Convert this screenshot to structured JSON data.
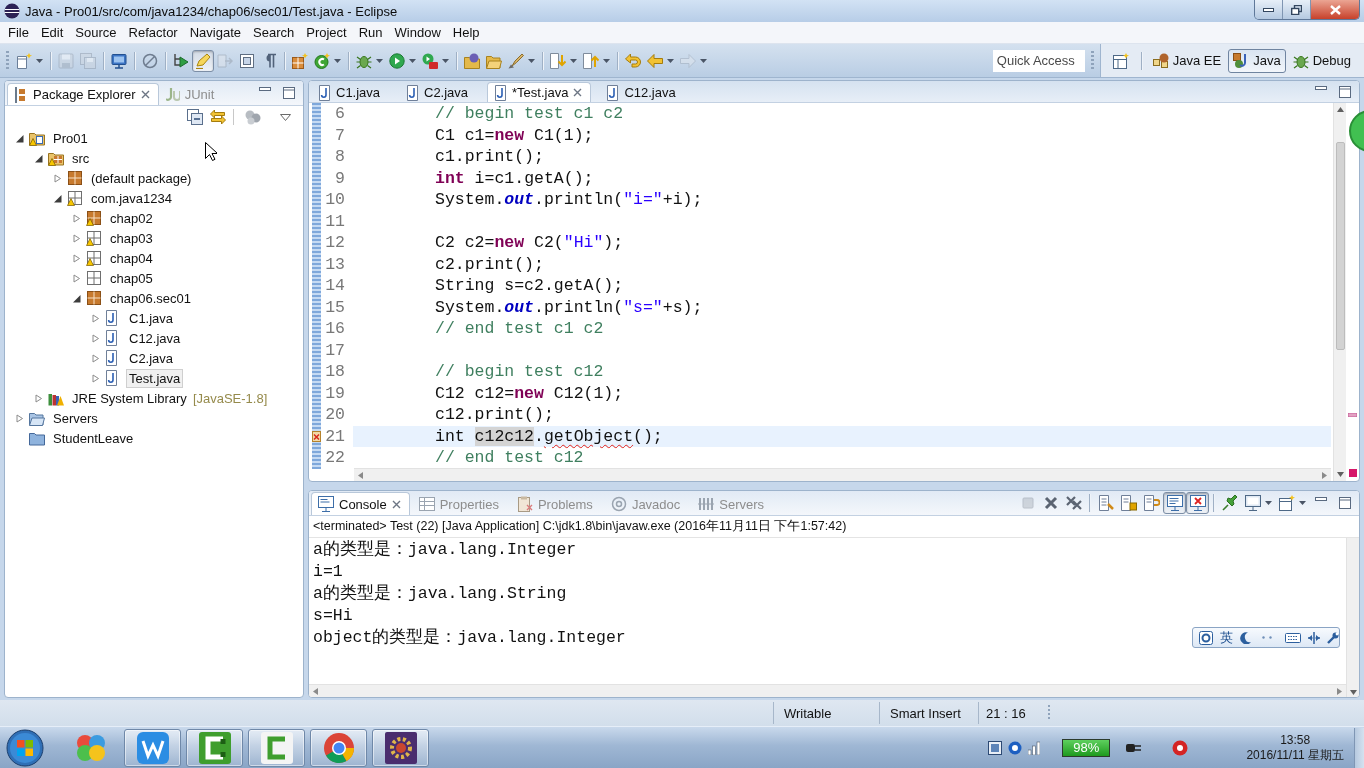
{
  "window": {
    "title": "Java - Pro01/src/com/java1234/chap06/sec01/Test.java - Eclipse"
  },
  "menu": [
    "File",
    "Edit",
    "Source",
    "Refactor",
    "Navigate",
    "Search",
    "Project",
    "Run",
    "Window",
    "Help"
  ],
  "toolbar": {
    "buttons": [
      {
        "pressed": false,
        "menu": true,
        "disabled": false
      },
      {
        "pressed": false,
        "menu": false,
        "disabled": true
      },
      {
        "pressed": false,
        "menu": false,
        "disabled": true
      },
      {
        "pressed": false,
        "menu": false,
        "disabled": false
      },
      {
        "pressed": false,
        "menu": false,
        "disabled": false
      },
      {
        "pressed": false,
        "menu": false,
        "disabled": false
      },
      {
        "pressed": true,
        "menu": false,
        "disabled": false
      },
      {
        "pressed": false,
        "menu": false,
        "disabled": true
      },
      {
        "pressed": false,
        "menu": false,
        "disabled": false
      },
      {
        "pressed": false,
        "menu": false,
        "disabled": false
      },
      {
        "pressed": false,
        "menu": false,
        "disabled": false
      },
      {
        "pressed": false,
        "menu": true,
        "disabled": false
      },
      {
        "pressed": false,
        "menu": true,
        "disabled": false
      },
      {
        "pressed": false,
        "menu": true,
        "disabled": false
      },
      {
        "pressed": false,
        "menu": true,
        "disabled": false
      },
      {
        "pressed": false,
        "menu": false,
        "disabled": false
      },
      {
        "pressed": false,
        "menu": false,
        "disabled": false
      },
      {
        "pressed": false,
        "menu": true,
        "disabled": false
      },
      {
        "pressed": false,
        "menu": true,
        "disabled": false
      },
      {
        "pressed": false,
        "menu": true,
        "disabled": false
      },
      {
        "pressed": false,
        "menu": false,
        "disabled": false
      },
      {
        "pressed": false,
        "menu": true,
        "disabled": false
      },
      {
        "pressed": false,
        "menu": true,
        "disabled": true
      }
    ],
    "quick_access": {
      "placeholder": "Quick Access"
    },
    "perspectives": [
      {
        "label": "Java EE",
        "selected": false
      },
      {
        "label": "Java",
        "selected": true
      },
      {
        "label": "Debug",
        "selected": false
      }
    ]
  },
  "package_explorer": {
    "tabs": [
      {
        "label": "Package Explorer",
        "selected": true
      },
      {
        "label": "JUnit",
        "selected": false
      }
    ],
    "tree": [
      {
        "label": "Pro01",
        "kind": "project",
        "warning": true,
        "expanded": true,
        "selected": false,
        "children": [
          {
            "label": "src",
            "kind": "source-folder",
            "warning": true,
            "expanded": true,
            "selected": false,
            "children": [
              {
                "label": "(default package)",
                "kind": "package",
                "warning": false,
                "expanded": false,
                "selected": false
              },
              {
                "label": "com.java1234",
                "kind": "empty-package",
                "warning": true,
                "expanded": true,
                "selected": false,
                "children": [
                  {
                    "label": "chap02",
                    "kind": "package",
                    "warning": true,
                    "expanded": false,
                    "selected": false
                  },
                  {
                    "label": "chap03",
                    "kind": "empty-package",
                    "warning": true,
                    "expanded": false,
                    "selected": false
                  },
                  {
                    "label": "chap04",
                    "kind": "empty-package",
                    "warning": true,
                    "expanded": false,
                    "selected": false
                  },
                  {
                    "label": "chap05",
                    "kind": "empty-package",
                    "warning": false,
                    "expanded": false,
                    "selected": false
                  },
                  {
                    "label": "chap06.sec01",
                    "kind": "package",
                    "warning": false,
                    "expanded": true,
                    "selected": false,
                    "children": [
                      {
                        "label": "C1.java",
                        "kind": "java-file",
                        "warning": false,
                        "expanded": false,
                        "selected": false
                      },
                      {
                        "label": "C12.java",
                        "kind": "java-file",
                        "warning": false,
                        "expanded": false,
                        "selected": false
                      },
                      {
                        "label": "C2.java",
                        "kind": "java-file",
                        "warning": false,
                        "expanded": false,
                        "selected": false
                      },
                      {
                        "label": "Test.java",
                        "kind": "java-file",
                        "warning": false,
                        "expanded": false,
                        "selected": true
                      }
                    ]
                  }
                ]
              }
            ]
          },
          {
            "label": "JRE System Library",
            "decoration": "[JavaSE-1.8]",
            "kind": "library",
            "warning": false,
            "expanded": false,
            "selected": false
          }
        ]
      },
      {
        "label": "Servers",
        "kind": "folder",
        "warning": false,
        "expanded": false,
        "selected": false
      },
      {
        "label": "StudentLeave",
        "kind": "closed-project",
        "warning": false,
        "selected": false
      }
    ]
  },
  "editor": {
    "tabs": [
      {
        "label": "C1.java",
        "selected": false
      },
      {
        "label": "C2.java",
        "selected": false
      },
      {
        "label": "*Test.java",
        "selected": true
      },
      {
        "label": "C12.java",
        "selected": false
      }
    ],
    "lines": [
      {
        "number": "6",
        "current": false,
        "error_marker": false,
        "tokens": [
          {
            "text": "// begin test c1 c2",
            "kind": "comment"
          }
        ]
      },
      {
        "number": "7",
        "current": false,
        "error_marker": false,
        "tokens": [
          {
            "text": "C1 c1=",
            "kind": "plain"
          },
          {
            "text": "new",
            "kind": "keyword"
          },
          {
            "text": " C1(1);",
            "kind": "plain"
          }
        ]
      },
      {
        "number": "8",
        "current": false,
        "error_marker": false,
        "tokens": [
          {
            "text": "c1.print();",
            "kind": "plain"
          }
        ]
      },
      {
        "number": "9",
        "current": false,
        "error_marker": false,
        "tokens": [
          {
            "text": "int",
            "kind": "keyword"
          },
          {
            "text": " i=c1.getA();",
            "kind": "plain"
          }
        ]
      },
      {
        "number": "10",
        "current": false,
        "error_marker": false,
        "tokens": [
          {
            "text": "System.",
            "kind": "plain"
          },
          {
            "text": "out",
            "kind": "field"
          },
          {
            "text": ".println(",
            "kind": "plain"
          },
          {
            "text": "\"i=\"",
            "kind": "string"
          },
          {
            "text": "+i);",
            "kind": "plain"
          }
        ]
      },
      {
        "number": "11",
        "current": false,
        "error_marker": false
      },
      {
        "number": "12",
        "current": false,
        "error_marker": false,
        "tokens": [
          {
            "text": "C2 c2=",
            "kind": "plain"
          },
          {
            "text": "new",
            "kind": "keyword"
          },
          {
            "text": " C2(",
            "kind": "plain"
          },
          {
            "text": "\"Hi\"",
            "kind": "string"
          },
          {
            "text": ");",
            "kind": "plain"
          }
        ]
      },
      {
        "number": "13",
        "current": false,
        "error_marker": false,
        "tokens": [
          {
            "text": "c2.print();",
            "kind": "plain"
          }
        ]
      },
      {
        "number": "14",
        "current": false,
        "error_marker": false,
        "tokens": [
          {
            "text": "String s=c2.getA();",
            "kind": "plain"
          }
        ]
      },
      {
        "number": "15",
        "current": false,
        "error_marker": false,
        "tokens": [
          {
            "text": "System.",
            "kind": "plain"
          },
          {
            "text": "out",
            "kind": "field"
          },
          {
            "text": ".println(",
            "kind": "plain"
          },
          {
            "text": "\"s=\"",
            "kind": "string"
          },
          {
            "text": "+s);",
            "kind": "plain"
          }
        ]
      },
      {
        "number": "16",
        "current": false,
        "error_marker": false,
        "tokens": [
          {
            "text": "// end test c1 c2",
            "kind": "comment"
          }
        ]
      },
      {
        "number": "17",
        "current": false,
        "error_marker": false
      },
      {
        "number": "18",
        "current": false,
        "error_marker": false,
        "tokens": [
          {
            "text": "// begin test c12",
            "kind": "comment"
          }
        ]
      },
      {
        "number": "19",
        "current": false,
        "error_marker": false,
        "tokens": [
          {
            "text": "C12 c12=",
            "kind": "plain"
          },
          {
            "text": "new",
            "kind": "keyword"
          },
          {
            "text": " C12(1);",
            "kind": "plain"
          }
        ]
      },
      {
        "number": "20",
        "current": false,
        "error_marker": false,
        "tokens": [
          {
            "text": "c12.print();",
            "kind": "plain"
          }
        ]
      },
      {
        "number": "21",
        "current": true,
        "error_marker": true,
        "tokens": [
          {
            "text": "int ",
            "kind": "plain"
          },
          {
            "text": "c12c12",
            "kind": "occurrence"
          },
          {
            "text": ".",
            "kind": "plain"
          },
          {
            "text": "getObject",
            "kind": "error"
          },
          {
            "text": "();",
            "kind": "plain"
          }
        ]
      },
      {
        "number": "22",
        "current": false,
        "error_marker": false,
        "tokens": [
          {
            "text": "// end test c12",
            "kind": "comment"
          }
        ]
      }
    ]
  },
  "console": {
    "tabs": [
      {
        "label": "Console",
        "selected": true
      },
      {
        "label": "Properties",
        "selected": false
      },
      {
        "label": "Problems",
        "selected": false
      },
      {
        "label": "Javadoc",
        "selected": false
      },
      {
        "label": "Servers",
        "selected": false
      }
    ],
    "buttons": [
      {
        "pressed": false,
        "menu": false,
        "disabled": true
      },
      {
        "pressed": false,
        "menu": false,
        "disabled": false
      },
      {
        "pressed": false,
        "menu": false,
        "disabled": false
      },
      {
        "pressed": false,
        "menu": false,
        "disabled": false
      },
      {
        "pressed": false,
        "menu": false,
        "disabled": false
      },
      {
        "pressed": false,
        "menu": false,
        "disabled": false
      },
      {
        "pressed": true,
        "menu": false,
        "disabled": false
      },
      {
        "pressed": true,
        "menu": false,
        "disabled": false
      },
      {
        "pressed": false,
        "menu": false,
        "disabled": false
      },
      {
        "pressed": false,
        "menu": true,
        "disabled": false
      },
      {
        "pressed": false,
        "menu": true,
        "disabled": false
      }
    ],
    "header": "<terminated> Test (22) [Java Application] C:\\jdk1.8\\bin\\javaw.exe (2016年11月11日 下午1:57:42)",
    "output": [
      "a的类型是：java.lang.Integer",
      "i=1",
      "a的类型是：java.lang.String",
      "s=Hi",
      "object的类型是：java.lang.Integer"
    ]
  },
  "ime_toolbar": {
    "mode": "英"
  },
  "status_bar": {
    "write_mode": "Writable",
    "insert_mode": "Smart Insert",
    "position": "21 : 16"
  },
  "taskbar": {
    "apps": [
      {
        "running": false
      },
      {
        "running": true
      },
      {
        "running": true
      },
      {
        "running": true
      },
      {
        "running": true
      },
      {
        "running": true
      }
    ],
    "battery": "98%",
    "time": "13:58",
    "date": "2016/11/11 星期五"
  }
}
